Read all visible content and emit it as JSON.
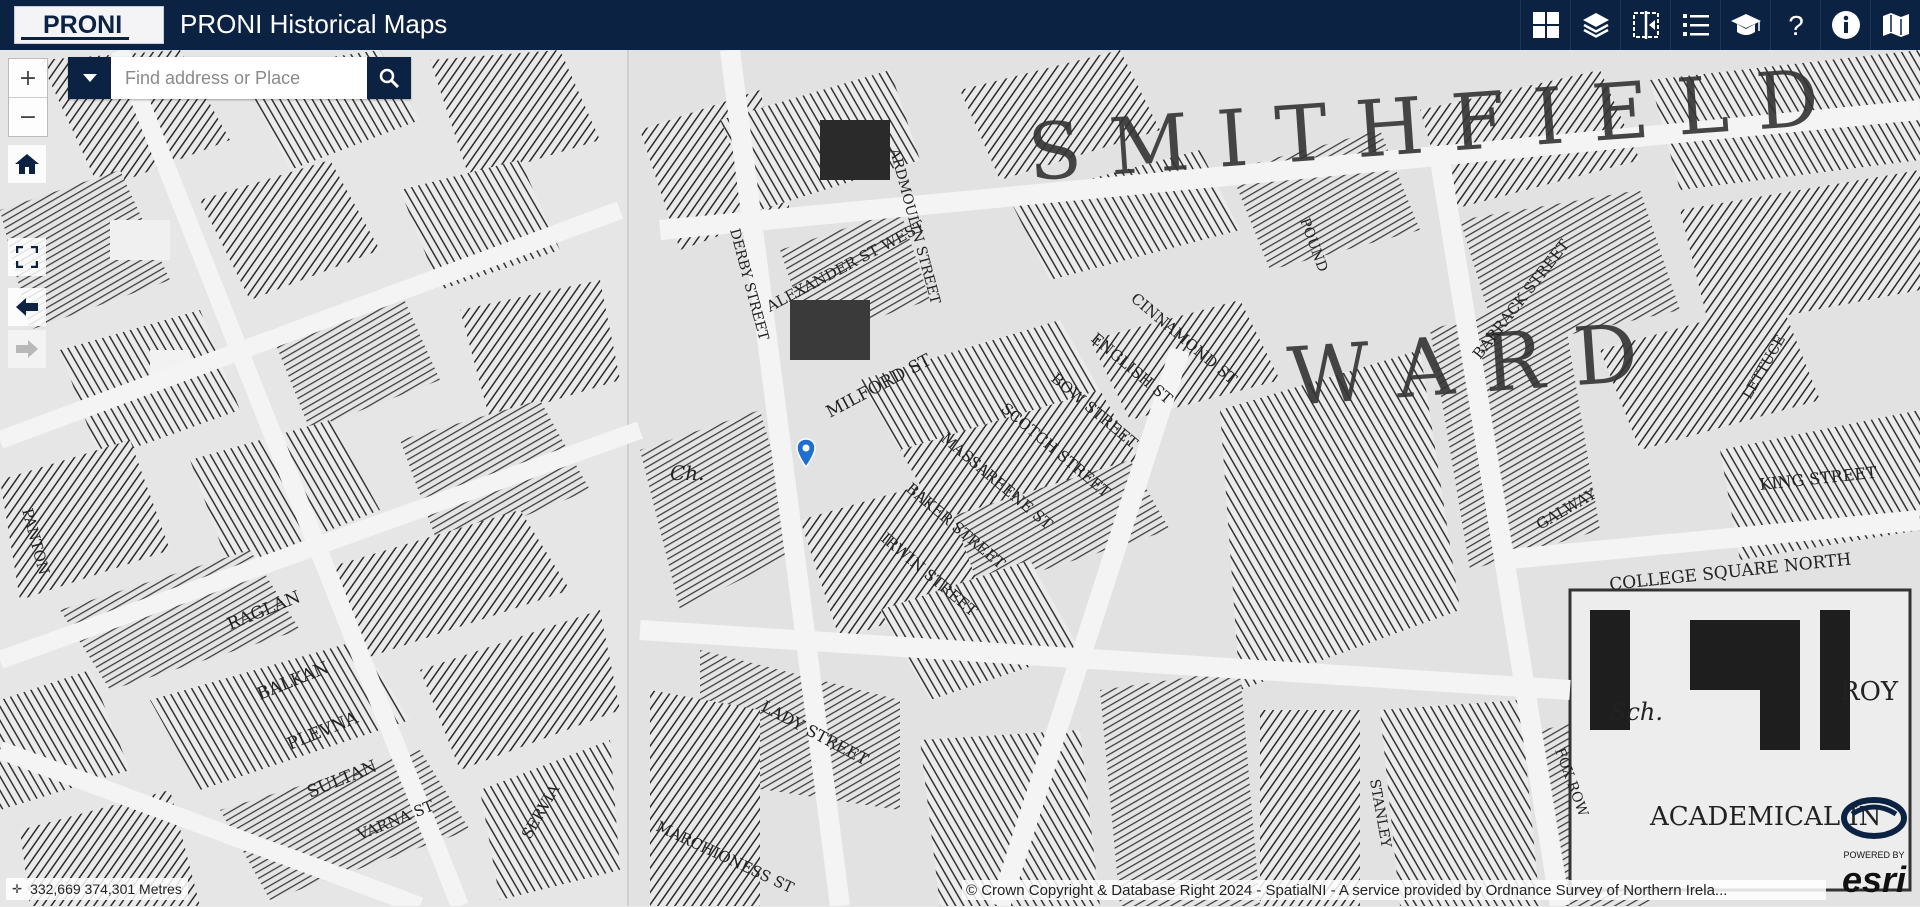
{
  "header": {
    "logo_text": "PRONI",
    "title": "PRONI Historical Maps",
    "background": "#0b2243",
    "tools": [
      {
        "name": "basemap-gallery-button",
        "icon": "grid-icon"
      },
      {
        "name": "layer-list-button",
        "icon": "layers-icon"
      },
      {
        "name": "swipe-button",
        "icon": "swipe-icon"
      },
      {
        "name": "legend-button",
        "icon": "list-icon"
      },
      {
        "name": "education-button",
        "icon": "mortarboard-icon"
      },
      {
        "name": "help-button",
        "icon": "question-icon"
      },
      {
        "name": "info-button",
        "icon": "info-icon"
      },
      {
        "name": "map-button",
        "icon": "map-icon"
      }
    ]
  },
  "map_controls": {
    "zoom_in": "+",
    "zoom_out": "−",
    "home_icon": "home-icon",
    "fullscreen_icon": "fullscreen-icon",
    "back_icon": "arrow-left-icon",
    "forward_icon": "arrow-right-icon"
  },
  "search": {
    "placeholder": "Find address or Place",
    "dropdown_icon": "caret-down-icon",
    "search_icon": "search-icon"
  },
  "coordinates": {
    "text": "332,669 374,301 Metres"
  },
  "attribution": {
    "text": "© Crown Copyright & Database Right 2024 - SpatialNI - A service provided by Ordnance Survey of Northern Irela..."
  },
  "esri": {
    "powered_by": "POWERED BY",
    "brand": "esri"
  },
  "map_labels": [
    "SMITHFIELD",
    "WARD",
    "MILFORD ST",
    "ALEXANDER ST WEST",
    "CINNAMOND ST",
    "ENGLISH ST",
    "BOW STREET",
    "SCOTCH STREET",
    "MASSAREENE ST",
    "BAKER STREET",
    "IRWIN STREET",
    "BARRACK STREET",
    "COLLEGE SQUARE NORTH",
    "KING STREET",
    "GALWAY",
    "LADY STREET",
    "ACADEMICAL IN",
    "ROY",
    "Sch.",
    "FOX ROW",
    "STANLEY",
    "MARCHIONESS ST",
    "BALKAN",
    "PLEVNA",
    "SULTAN",
    "VARNA ST",
    "SERVIA",
    "RAGLAN",
    "PANTON",
    "DERBY STREET",
    "ARDMOULIN STREET",
    "POUND",
    "LETTUCE",
    "Ch."
  ],
  "colors": {
    "accent": "#0b2243",
    "marker": "#1f6fd1"
  }
}
